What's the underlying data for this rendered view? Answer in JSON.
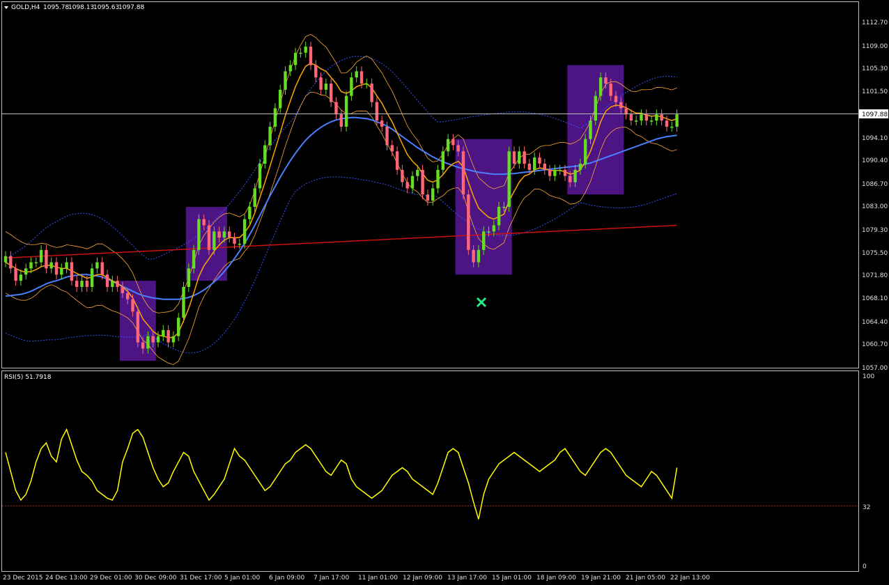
{
  "header": {
    "symbol": "GOLD,H4",
    "open": "1095.78",
    "high": "1098.13",
    "low": "1095.63",
    "close": "1097.88"
  },
  "current_price": "1097.88",
  "price_axis": [
    "1112.70",
    "1109.00",
    "1105.30",
    "1101.50",
    "1094.10",
    "1090.40",
    "1086.70",
    "1083.00",
    "1079.30",
    "1075.50",
    "1071.80",
    "1068.10",
    "1064.40",
    "1060.70",
    "1057.00"
  ],
  "rsi": {
    "label": "RSI(5) 51.7918",
    "levels": [
      "100",
      "32",
      "0"
    ]
  },
  "time_axis": [
    "23 Dec 2015",
    "24 Dec 13:00",
    "29 Dec 01:00",
    "30 Dec 09:00",
    "31 Dec 17:00",
    "5 Jan 01:00",
    "6 Jan 09:00",
    "7 Jan 17:00",
    "11 Jan 01:00",
    "12 Jan 09:00",
    "13 Jan 17:00",
    "15 Jan 01:00",
    "18 Jan 09:00",
    "19 Jan 21:00",
    "21 Jan 05:00",
    "22 Jan 13:00"
  ],
  "colors": {
    "background": "#000000",
    "bull": "#66dd22",
    "bear": "#ff6677",
    "box": "#5a189a",
    "ma_fast": "#ffa500",
    "ma_slow": "#4a7fff",
    "ma_long": "#cc1111",
    "bands": "#3355ff",
    "env": "#ffaa33",
    "rsi_line": "#ffff00",
    "marker": "#22ee88"
  },
  "chart_data": {
    "type": "candlestick",
    "symbol": "GOLD,H4",
    "ylim": [
      1057.0,
      1116.0
    ],
    "closes": [
      1075,
      1073,
      1071,
      1072,
      1073,
      1074,
      1074,
      1076,
      1073,
      1074,
      1072,
      1073,
      1074,
      1071,
      1070,
      1071,
      1070,
      1073,
      1074,
      1072,
      1070,
      1071,
      1070,
      1069,
      1068,
      1066,
      1061,
      1060,
      1062,
      1061,
      1062,
      1063,
      1061,
      1062,
      1065,
      1070,
      1073,
      1076,
      1081,
      1080,
      1076,
      1079,
      1078,
      1079,
      1078,
      1077,
      1077,
      1081,
      1083,
      1086,
      1090,
      1093,
      1096,
      1099,
      1102,
      1105,
      1106,
      1108,
      1108,
      1109,
      1106,
      1104,
      1102,
      1103,
      1100,
      1098,
      1096,
      1101,
      1104,
      1105,
      1103,
      1103,
      1100,
      1097,
      1096,
      1093,
      1092,
      1089,
      1087,
      1086,
      1088,
      1089,
      1085,
      1084,
      1086,
      1089,
      1092,
      1094,
      1093,
      1092,
      1085,
      1076,
      1074,
      1076,
      1079,
      1079,
      1080,
      1083,
      1083,
      1092,
      1090,
      1092,
      1090,
      1089,
      1091,
      1090,
      1089,
      1088,
      1089,
      1089,
      1088,
      1087,
      1089,
      1090,
      1094,
      1097,
      1101,
      1104,
      1103,
      1101,
      1100,
      1099,
      1098,
      1097,
      1097,
      1098,
      1097,
      1097,
      1098,
      1097,
      1096,
      1096,
      1098
    ],
    "ma_fast": [
      1074,
      1073.5,
      1073,
      1072.6,
      1072.4,
      1072.5,
      1072.8,
      1073.3,
      1073.5,
      1073.5,
      1073.2,
      1073,
      1073,
      1072.6,
      1072.2,
      1071.8,
      1071.4,
      1071.6,
      1072,
      1072,
      1071.5,
      1071,
      1070.6,
      1070,
      1069.3,
      1068.2,
      1066.5,
      1064.8,
      1063.8,
      1062.8,
      1062.2,
      1062,
      1061.8,
      1061.8,
      1062.6,
      1064.5,
      1066.5,
      1069,
      1071.7,
      1073.4,
      1074.6,
      1075.8,
      1076.8,
      1077.6,
      1078,
      1078,
      1078,
      1078.8,
      1080,
      1082,
      1084.5,
      1087,
      1089.6,
      1092.3,
      1095,
      1097.8,
      1100.2,
      1102.5,
      1104.3,
      1105.8,
      1106.3,
      1106,
      1105.4,
      1105,
      1104,
      1103,
      1101.7,
      1101.4,
      1101.8,
      1102.5,
      1102.8,
      1103,
      1102.3,
      1101,
      1099.8,
      1098.2,
      1096.8,
      1095,
      1093.2,
      1091.5,
      1090.4,
      1089.6,
      1088.4,
      1087.3,
      1087,
      1087.4,
      1088.2,
      1089.3,
      1090,
      1090.4,
      1089.5,
      1087,
      1084.7,
      1082.8,
      1082,
      1081.3,
      1081,
      1081.4,
      1081.8,
      1084,
      1085.5,
      1087,
      1088,
      1088.3,
      1089,
      1089.3,
      1089.2,
      1088.9,
      1088.9,
      1088.9,
      1088.7,
      1088.3,
      1088.5,
      1089,
      1090.3,
      1092,
      1094.3,
      1096.8,
      1098.5,
      1099.2,
      1099.5,
      1099.4,
      1099.1,
      1098.6,
      1098.2,
      1098.2,
      1097.9,
      1097.7,
      1097.8,
      1097.6,
      1097.3,
      1097,
      1097.3
    ],
    "ma_slow": [
      1068.5,
      1068.6,
      1068.7,
      1068.8,
      1069,
      1069.3,
      1069.7,
      1070.1,
      1070.5,
      1070.8,
      1071,
      1071.3,
      1071.6,
      1071.8,
      1071.9,
      1072,
      1072,
      1071.9,
      1071.8,
      1071.6,
      1071.3,
      1070.9,
      1070.5,
      1070.1,
      1069.7,
      1069.3,
      1068.9,
      1068.6,
      1068.4,
      1068.2,
      1068.1,
      1068,
      1068,
      1068,
      1068,
      1068.1,
      1068.3,
      1068.6,
      1069,
      1069.5,
      1070.1,
      1070.8,
      1071.6,
      1072.5,
      1073.5,
      1074.6,
      1075.8,
      1077.1,
      1078.5,
      1080,
      1081.6,
      1083.2,
      1084.8,
      1086.3,
      1087.8,
      1089.2,
      1090.5,
      1091.7,
      1092.8,
      1093.8,
      1094.6,
      1095.3,
      1095.9,
      1096.4,
      1096.8,
      1097.1,
      1097.3,
      1097.4,
      1097.5,
      1097.5,
      1097.4,
      1097.3,
      1097.1,
      1096.8,
      1096.5,
      1096.1,
      1095.6,
      1095,
      1094.4,
      1093.8,
      1093.2,
      1092.6,
      1092.1,
      1091.6,
      1091.1,
      1090.7,
      1090.3,
      1090,
      1089.7,
      1089.4,
      1089.2,
      1089,
      1088.8,
      1088.6,
      1088.5,
      1088.4,
      1088.3,
      1088.3,
      1088.3,
      1088.4,
      1088.4,
      1088.5,
      1088.6,
      1088.7,
      1088.8,
      1088.9,
      1089,
      1089.1,
      1089.2,
      1089.3,
      1089.4,
      1089.5,
      1089.6,
      1089.7,
      1089.9,
      1090.1,
      1090.4,
      1090.7,
      1091,
      1091.3,
      1091.6,
      1091.9,
      1092.2,
      1092.5,
      1092.8,
      1093.1,
      1093.4,
      1093.7,
      1094,
      1094.2,
      1094.4,
      1094.5,
      1094.6
    ],
    "ma_long_start": 1074.7,
    "ma_long_end": 1080.0,
    "rsi_values": [
      60,
      50,
      40,
      35,
      38,
      45,
      55,
      62,
      65,
      58,
      55,
      67,
      72,
      64,
      56,
      50,
      48,
      45,
      40,
      38,
      36,
      35,
      40,
      55,
      62,
      70,
      72,
      68,
      60,
      52,
      46,
      42,
      44,
      50,
      55,
      60,
      58,
      50,
      45,
      40,
      35,
      38,
      42,
      46,
      54,
      62,
      58,
      56,
      52,
      48,
      44,
      40,
      42,
      46,
      50,
      54,
      56,
      60,
      62,
      64,
      62,
      58,
      54,
      50,
      48,
      52,
      56,
      54,
      46,
      42,
      40,
      38,
      36,
      38,
      40,
      44,
      48,
      50,
      52,
      50,
      46,
      44,
      42,
      40,
      38,
      44,
      52,
      60,
      62,
      60,
      52,
      44,
      34,
      25,
      38,
      46,
      50,
      54,
      56,
      58,
      60,
      58,
      56,
      54,
      52,
      50,
      52,
      54,
      56,
      60,
      62,
      58,
      54,
      50,
      48,
      52,
      56,
      60,
      62,
      60,
      56,
      52,
      48,
      46,
      44,
      42,
      46,
      50,
      48,
      44,
      40,
      36,
      52
    ],
    "rsi_ylim": [
      0,
      100
    ],
    "rsi_level": 32
  }
}
